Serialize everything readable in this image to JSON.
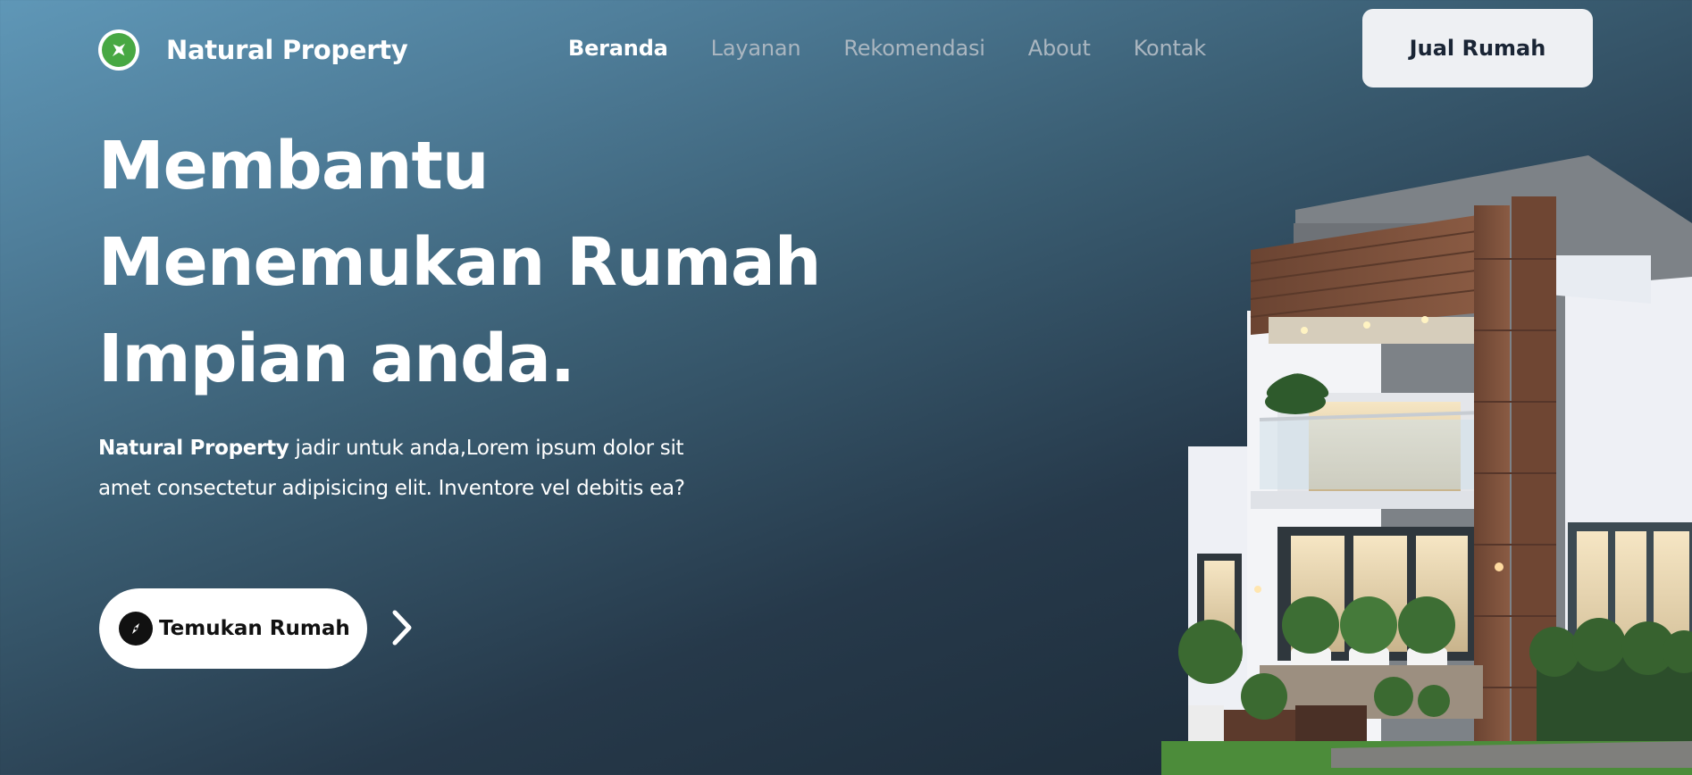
{
  "brand": {
    "name": "Natural Property",
    "logo_icon": "plane-icon",
    "logo_color": "#48a843"
  },
  "nav": {
    "items": [
      {
        "label": "Beranda",
        "active": true
      },
      {
        "label": "Layanan",
        "active": false
      },
      {
        "label": "Rekomendasi",
        "active": false
      },
      {
        "label": "About",
        "active": false
      },
      {
        "label": "Kontak",
        "active": false
      }
    ],
    "cta_label": "Jual Rumah"
  },
  "hero": {
    "title_lines": [
      "Membantu",
      "Menemukan Rumah",
      "Impian anda."
    ],
    "desc_bold": "Natural Property",
    "desc_line1": " jadir untuk anda,Lorem ipsum dolor sit",
    "desc_line2": "amet consectetur adipisicing elit. Inventore vel debitis ea?",
    "button_label": "Temukan Rumah",
    "button_icon": "compass-icon",
    "arrow_icon": "chevron-right-icon"
  },
  "colors": {
    "background_top": "#5f97b7",
    "background_bottom": "#1a2733",
    "nav_inactive": "#aab6c0",
    "cta_bg": "#eef0f3",
    "cta_text": "#1a2535"
  }
}
